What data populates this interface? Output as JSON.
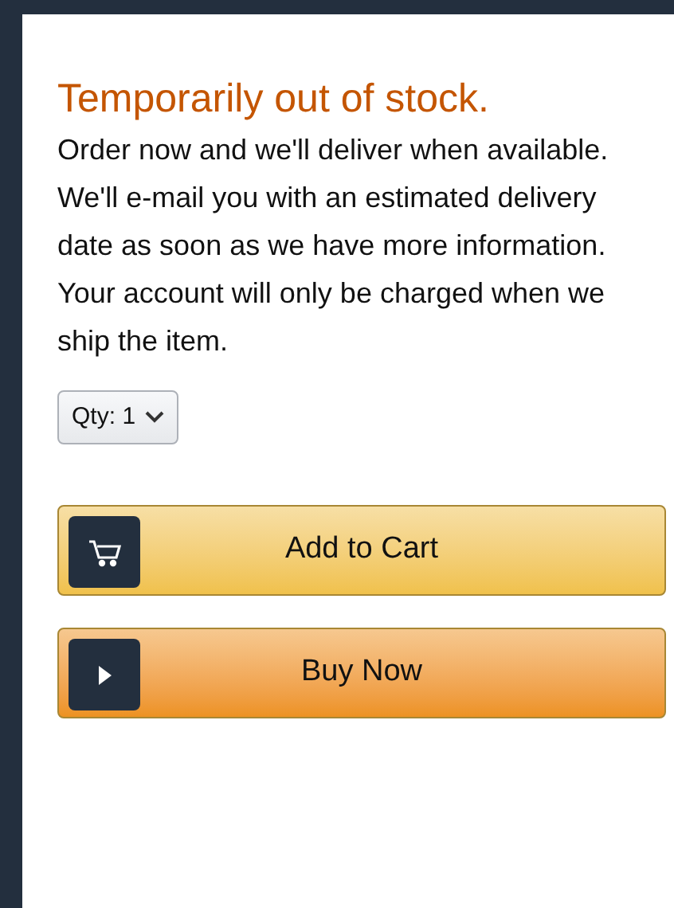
{
  "availability": {
    "title": "Temporarily out of stock.",
    "message": "Order now and we'll deliver when available. We'll e-mail you with an estimated delivery date as soon as we have more information. Your account will only be charged when we ship the item."
  },
  "quantity": {
    "label": "Qty:",
    "value": "1"
  },
  "buttons": [
    {
      "kind": "cart",
      "label": "Add to Cart"
    },
    {
      "kind": "buy",
      "label": "Buy Now"
    }
  ]
}
